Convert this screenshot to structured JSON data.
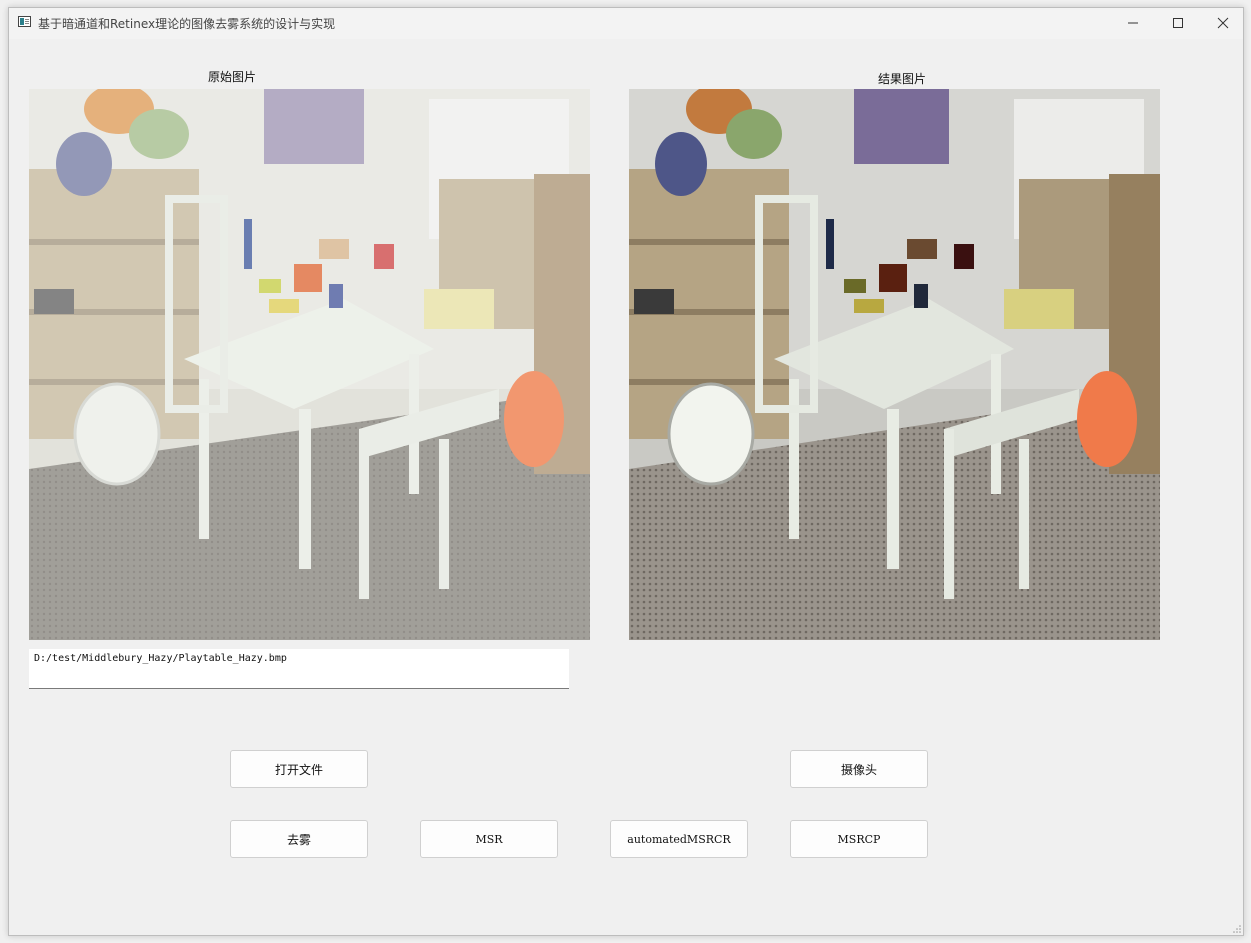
{
  "window": {
    "title": "基于暗通道和Retinex理论的图像去雾系统的设计与实现"
  },
  "panels": {
    "original_caption": "原始图片",
    "result_caption": "结果图片"
  },
  "file_path": "D:/test/Middlebury_Hazy/Playtable_Hazy.bmp",
  "buttons": {
    "open_file": "打开文件",
    "camera": "摄像头",
    "dehaze": "去雾",
    "msr": "MSR",
    "automated_msrcr": "automatedMSRCR",
    "msrcp": "MSRCP"
  }
}
